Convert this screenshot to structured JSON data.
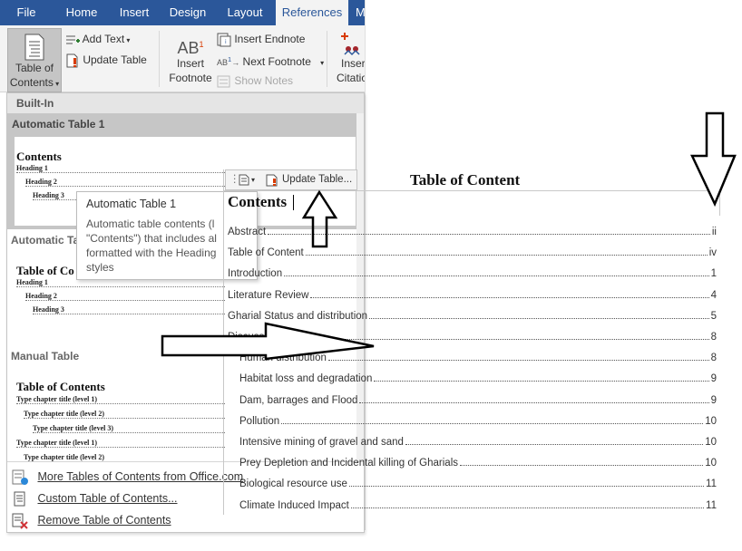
{
  "ribbon": {
    "tabs": [
      {
        "label": "File",
        "active": false
      },
      {
        "label": "Home",
        "active": false
      },
      {
        "label": "Insert",
        "active": false
      },
      {
        "label": "Design",
        "active": false
      },
      {
        "label": "Layout",
        "active": false
      },
      {
        "label": "References",
        "active": true
      },
      {
        "label": "M",
        "active": false
      }
    ],
    "toc_button": {
      "line1": "Table of",
      "line2": "Contents"
    },
    "add_text": "Add Text",
    "update_table": "Update Table",
    "insert_footnote": {
      "line1": "Insert",
      "line2": "Footnote"
    },
    "insert_endnote": "Insert Endnote",
    "next_footnote": "Next Footnote",
    "show_notes": "Show Notes",
    "insert_citation": {
      "line1": "Inser",
      "line2": "Citatio"
    },
    "colors": {
      "tabbar": "#2b579a",
      "ribbon": "#f3f3f3",
      "accent_red": "#d83b01"
    }
  },
  "gallery": {
    "builtin_header": "Built-In",
    "auto1": {
      "title": "Automatic Table 1",
      "thumb_title": "Contents",
      "lines": [
        "Heading 1",
        "Heading 2",
        "Heading 3"
      ]
    },
    "auto2": {
      "title": "Automatic Ta",
      "thumb_title": "Table of Co",
      "lines": [
        "Heading 1",
        "Heading 2",
        "Heading 3"
      ]
    },
    "manual": {
      "title": "Manual Table",
      "thumb_title": "Table of Contents",
      "lines": [
        "Type chapter title (level 1)",
        "Type chapter title (level 2)",
        "Type chapter title (level 3)",
        "Type chapter title (level 1)",
        "Type chapter title (level 2)"
      ]
    },
    "footer": {
      "more": "More Tables of Contents from Office.com",
      "custom": "Custom Table of Contents...",
      "remove": "Remove Table of Contents"
    }
  },
  "tooltip": {
    "title": "Automatic Table 1",
    "body": "Automatic table contents (l\n\"Contents\") that includes al\nformatted with the Heading\nstyles"
  },
  "document": {
    "title": "Table of Content",
    "control_tag": "Update Table...",
    "contents_heading": "Contents",
    "entries": [
      {
        "text": "Abstract",
        "page": "ii",
        "level": 1
      },
      {
        "text": "Table of Content",
        "page": "iv",
        "level": 1
      },
      {
        "text": "Introduction",
        "page": "1",
        "level": 1
      },
      {
        "text": "Literature Review",
        "page": "4",
        "level": 1
      },
      {
        "text": "Gharial Status and distribution",
        "page": "5",
        "level": 1
      },
      {
        "text": "Discussion",
        "page": "8",
        "level": 1
      },
      {
        "text": "Human distribution",
        "page": "8",
        "level": 2
      },
      {
        "text": "Habitat loss and degradation",
        "page": "9",
        "level": 2
      },
      {
        "text": "Dam, barrages and Flood",
        "page": "9",
        "level": 2
      },
      {
        "text": "Pollution",
        "page": "10",
        "level": 2
      },
      {
        "text": "Intensive mining of gravel and sand",
        "page": "10",
        "level": 2
      },
      {
        "text": "Prey Depletion and Incidental killing of Gharials",
        "page": "10",
        "level": 2
      },
      {
        "text": "Biological resource use",
        "page": "11",
        "level": 2
      },
      {
        "text": "Climate Induced Impact",
        "page": "11",
        "level": 2
      }
    ]
  }
}
